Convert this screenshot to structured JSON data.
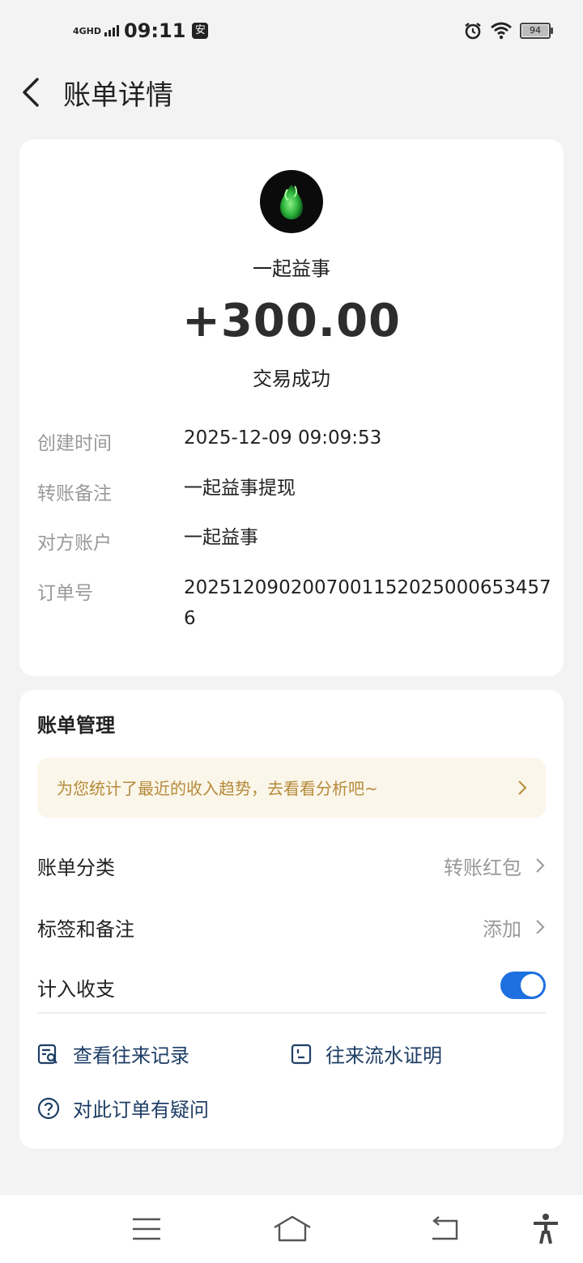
{
  "status_bar": {
    "network": "4GHD",
    "time": "09:11",
    "app_badge": "安",
    "battery_level": "94",
    "battery_fraction": 0.94
  },
  "header": {
    "title": "账单详情"
  },
  "transaction": {
    "merchant": "一起益事",
    "amount": "+300.00",
    "status": "交易成功"
  },
  "details": [
    {
      "label": "创建时间",
      "value": "2025-12-09 09:09:53"
    },
    {
      "label": "转账备注",
      "value": "一起益事提现"
    },
    {
      "label": "对方账户",
      "value": "一起益事"
    },
    {
      "label": "订单号",
      "value": "20251209020070011520250006534576"
    }
  ],
  "management": {
    "title": "账单管理",
    "tip": "为您统计了最近的收入趋势，去看看分析吧~",
    "category": {
      "label": "账单分类",
      "value": "转账红包"
    },
    "tags": {
      "label": "标签和备注",
      "value": "添加"
    },
    "include": {
      "label": "计入收支",
      "enabled": true
    },
    "links": {
      "history": "查看往来记录",
      "statement": "往来流水证明",
      "question": "对此订单有疑问"
    }
  },
  "colors": {
    "accent": "#1e6fe0",
    "link": "#1e3e66",
    "tip_text": "#b58a3a",
    "tip_bg": "#fbf6ea"
  }
}
